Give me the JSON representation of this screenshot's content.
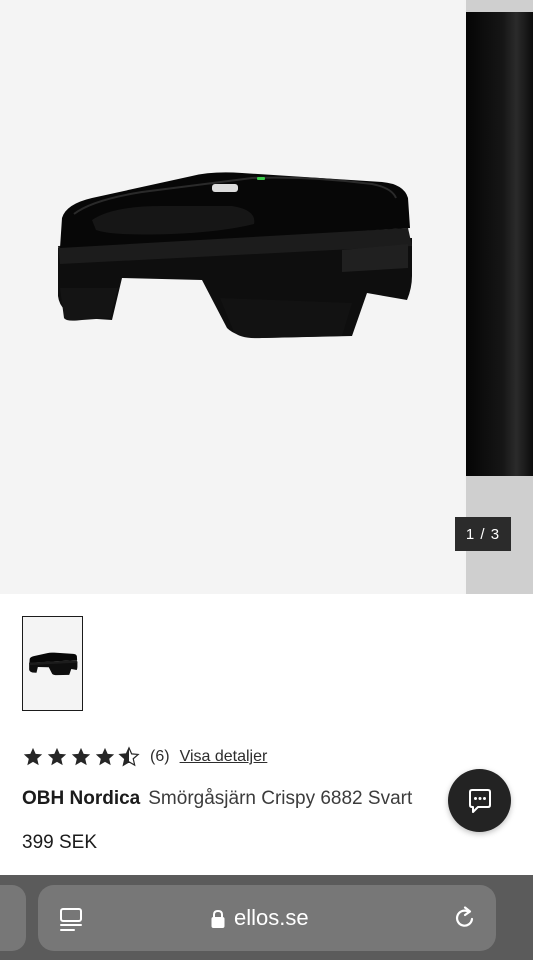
{
  "gallery": {
    "counter": "1 / 3",
    "product_image_alt": "OBH Nordica Smörgåsjärn Crispy 6882 Svart"
  },
  "rating": {
    "stars": 4.5,
    "count": "(6)",
    "details_link": "Visa detaljer"
  },
  "product": {
    "brand": "OBH Nordica",
    "name": "Smörgåsjärn Crispy 6882 Svart",
    "price": "399 SEK"
  },
  "browser": {
    "url": "ellos.se"
  },
  "icons": {
    "chat": "chat-bubble-icon",
    "menu": "page-menu-icon",
    "lock": "lock-icon",
    "reload": "reload-icon"
  },
  "colors": {
    "dark": "#232323",
    "browser_bar": "#5b5b5b",
    "pill": "#777777"
  }
}
